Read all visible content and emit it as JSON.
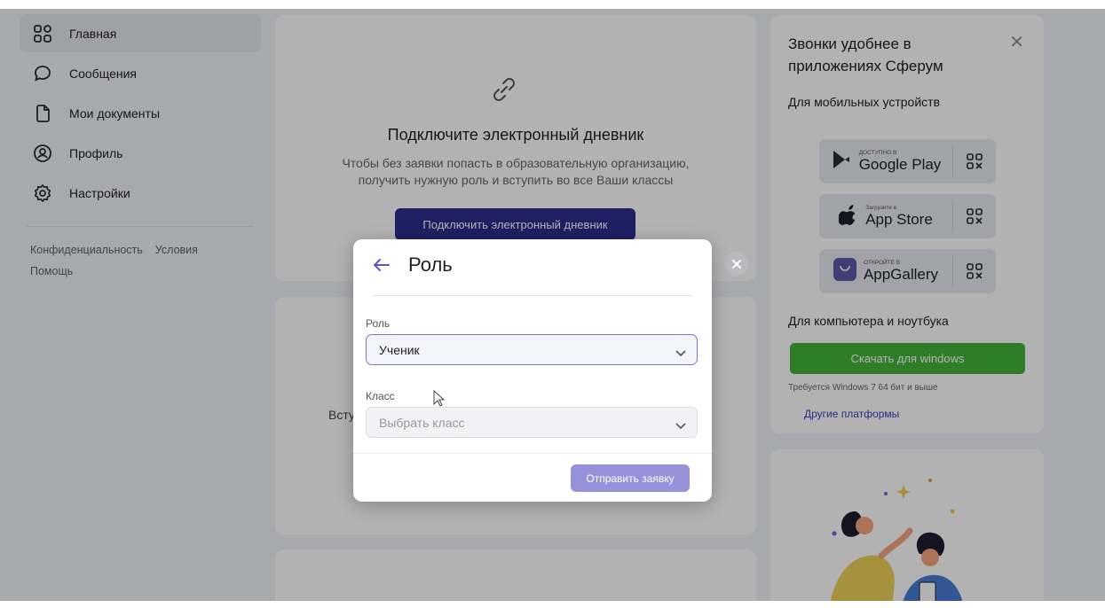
{
  "sidebar": {
    "items": [
      {
        "label": "Главная",
        "icon": "grid-icon",
        "active": true
      },
      {
        "label": "Сообщения",
        "icon": "chat-icon"
      },
      {
        "label": "Мои документы",
        "icon": "document-icon"
      },
      {
        "label": "Профиль",
        "icon": "profile-icon"
      },
      {
        "label": "Настройки",
        "icon": "gear-icon"
      }
    ],
    "links": {
      "privacy": "Конфиденциальность",
      "terms": "Условия",
      "help": "Помощь"
    }
  },
  "diary": {
    "title": "Подключите электронный дневник",
    "desc_line1": "Чтобы без заявки попасть в образовательную организацию,",
    "desc_line2": "получить нужную роль и вступить во все Ваши классы",
    "button": "Подключить электронный дневник"
  },
  "card2": {
    "partial_text": "Вступ"
  },
  "promo": {
    "title": "Звонки удобнее в приложениях Сферум",
    "mobile_label": "Для мобильных устройств",
    "stores": [
      {
        "small": "доступно в",
        "big": "Google Play",
        "icon": "google-play-icon"
      },
      {
        "small": "Загрузите в",
        "big": "App Store",
        "icon": "apple-icon"
      },
      {
        "small": "откройте в",
        "big": "AppGallery",
        "icon": "huawei-icon"
      }
    ],
    "desktop_label": "Для компьютера и ноутбука",
    "download_button": "Скачать для windows",
    "requirement": "Требуется Windows 7 64 бит и выше",
    "other_platforms": "Другие платформы"
  },
  "modal": {
    "title": "Роль",
    "role_label": "Роль",
    "role_value": "Ученик",
    "class_label": "Класс",
    "class_placeholder": "Выбрать класс",
    "submit": "Отправить заявку"
  },
  "colors": {
    "primary": "#2b2e8f",
    "accent": "#7b78c4",
    "submit": "#9592d9",
    "green": "#46b33c",
    "link": "#3a3cc0"
  }
}
